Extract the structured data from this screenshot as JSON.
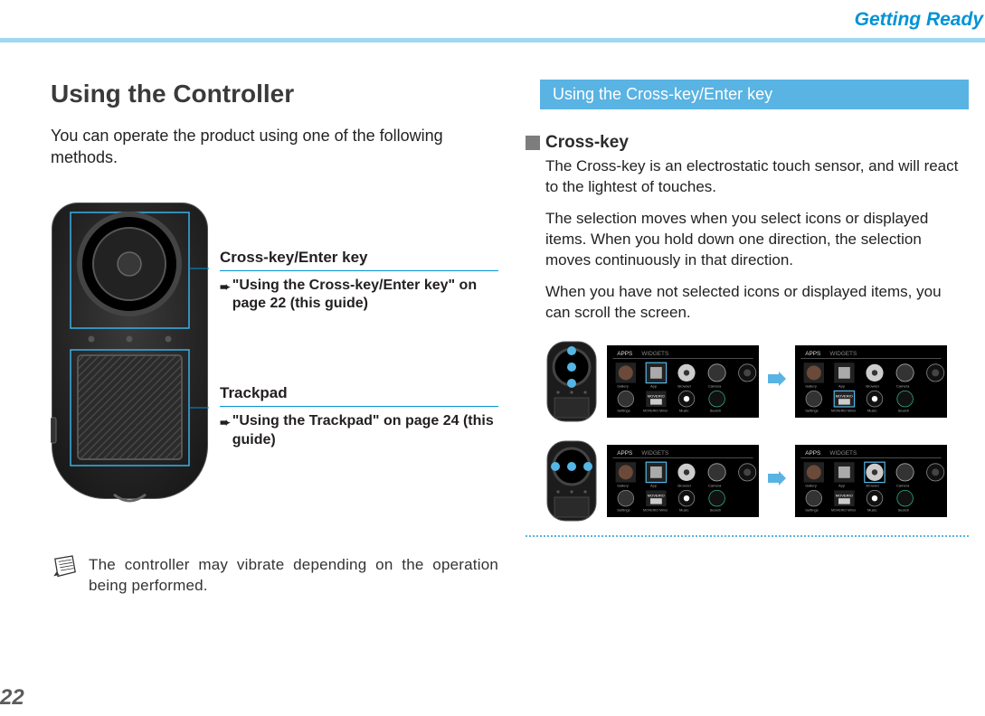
{
  "header": {
    "breadcrumb": "Getting Ready"
  },
  "page_number": "22",
  "left": {
    "title": "Using the Controller",
    "intro": "You can operate the product using one of the following methods.",
    "label1_title": "Cross-key/Enter key",
    "label1_ref": "\"Using the Cross-key/Enter key\" on page 22 (this guide)",
    "label2_title": "Trackpad",
    "label2_ref": "\"Using the Trackpad\" on page 24 (this guide)",
    "note": "The controller may vibrate depending on the operation being performed."
  },
  "right": {
    "subhead": "Using the Cross-key/Enter key",
    "sub_title": "Cross-key",
    "p1": "The Cross-key is an electrostatic touch sensor, and will react to the lightest of touches.",
    "p2": "The selection moves when you select icons or displayed items. When you hold down one direction, the selection moves continuously in that direction.",
    "p3": "When you have not selected icons or displayed items, you can scroll the screen.",
    "screen_tab1": "APPS",
    "screen_tab2": "WIDGETS",
    "icon_moverio": "MOVERIO",
    "icon_gallery": "Gallery",
    "icon_app": "App",
    "icon_browser": "Browser",
    "icon_camera": "Camera",
    "icon_settings": "Settings",
    "icon_mirror": "MOVERIO Mirror",
    "icon_music": "Music",
    "icon_search": "Search"
  }
}
